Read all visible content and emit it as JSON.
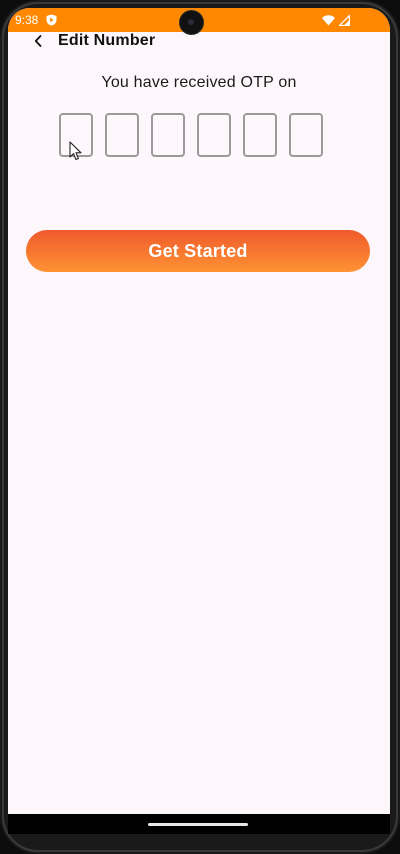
{
  "status_bar": {
    "time": "9:38",
    "app_icon": "shield-play-icon",
    "wifi_icon": "wifi-icon",
    "signal_icon": "cell-signal-icon",
    "background_color": "#ff8800"
  },
  "app_bar": {
    "back_icon": "chevron-left-icon",
    "title": "Edit Number"
  },
  "otp": {
    "message": "You have received OTP on",
    "digits": [
      "",
      "",
      "",
      "",
      "",
      ""
    ]
  },
  "cta": {
    "label": "Get Started",
    "gradient_top": "#ef5a2c",
    "gradient_bottom": "#ff9233"
  }
}
